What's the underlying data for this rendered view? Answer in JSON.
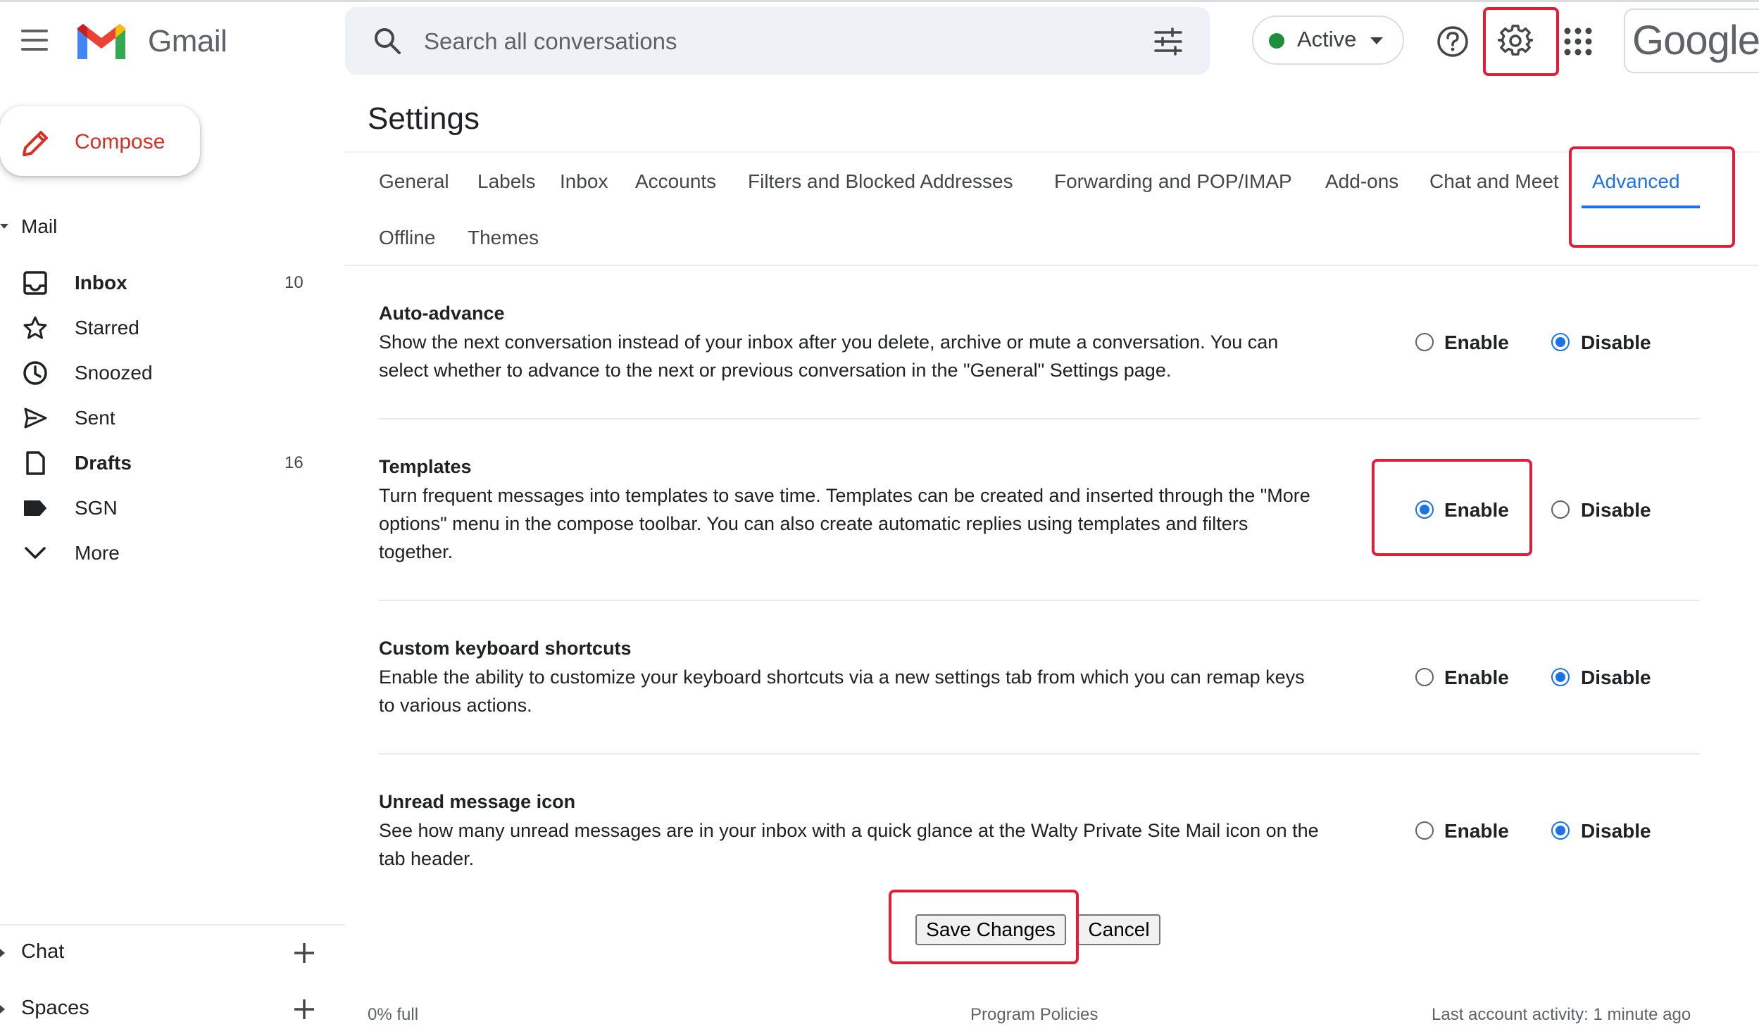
{
  "header": {
    "app_name": "Gmail",
    "search_placeholder": "Search all conversations",
    "status_label": "Active",
    "status_color": "#1e8e3e",
    "google_label": "Google",
    "icons": [
      "menu-icon",
      "gmail-logo",
      "search-icon",
      "tune-icon",
      "help-icon",
      "gear-icon",
      "apps-icon"
    ]
  },
  "sidebar": {
    "compose_label": "Compose",
    "mail_section": "Mail",
    "items": [
      {
        "label": "Inbox",
        "count": "10",
        "bold": true,
        "icon": "inbox-icon"
      },
      {
        "label": "Starred",
        "count": "",
        "bold": false,
        "icon": "star-icon"
      },
      {
        "label": "Snoozed",
        "count": "",
        "bold": false,
        "icon": "clock-icon"
      },
      {
        "label": "Sent",
        "count": "",
        "bold": false,
        "icon": "send-icon"
      },
      {
        "label": "Drafts",
        "count": "16",
        "bold": true,
        "icon": "draft-icon"
      },
      {
        "label": "SGN",
        "count": "",
        "bold": false,
        "icon": "label-icon"
      },
      {
        "label": "More",
        "count": "",
        "bold": false,
        "icon": "chevron-down-icon"
      }
    ],
    "chat_section": "Chat",
    "spaces_section": "Spaces"
  },
  "settings": {
    "title": "Settings",
    "tabs": [
      "General",
      "Labels",
      "Inbox",
      "Accounts",
      "Filters and Blocked Addresses",
      "Forwarding and POP/IMAP",
      "Add-ons",
      "Chat and Meet",
      "Advanced",
      "Offline",
      "Themes"
    ],
    "active_tab": "Advanced",
    "rows": [
      {
        "title": "Auto-advance",
        "desc": "Show the next conversation instead of your inbox after you delete, archive or mute a conversation. You can select whether to advance to the next or previous conversation in the \"General\" Settings page.",
        "enable_label": "Enable",
        "disable_label": "Disable",
        "selected": "Disable"
      },
      {
        "title": "Templates",
        "desc": "Turn frequent messages into templates to save time. Templates can be created and inserted through the \"More options\" menu in the compose toolbar. You can also create automatic replies using templates and filters together.",
        "enable_label": "Enable",
        "disable_label": "Disable",
        "selected": "Enable"
      },
      {
        "title": "Custom keyboard shortcuts",
        "desc": "Enable the ability to customize your keyboard shortcuts via a new settings tab from which you can remap keys to various actions.",
        "enable_label": "Enable",
        "disable_label": "Disable",
        "selected": "Disable"
      },
      {
        "title": "Unread message icon",
        "desc": "See how many unread messages are in your inbox with a quick glance at the Walty Private Site Mail icon on the tab header.",
        "enable_label": "Enable",
        "disable_label": "Disable",
        "selected": "Disable"
      }
    ],
    "save_label": "Save Changes",
    "cancel_label": "Cancel"
  },
  "footer": {
    "storage": "0% full",
    "policies": "Program Policies",
    "activity": "Last account activity: 1 minute ago"
  },
  "colors": {
    "accent": "#1a73e8",
    "highlight": "#e11d3a",
    "compose_text": "#d93025"
  }
}
